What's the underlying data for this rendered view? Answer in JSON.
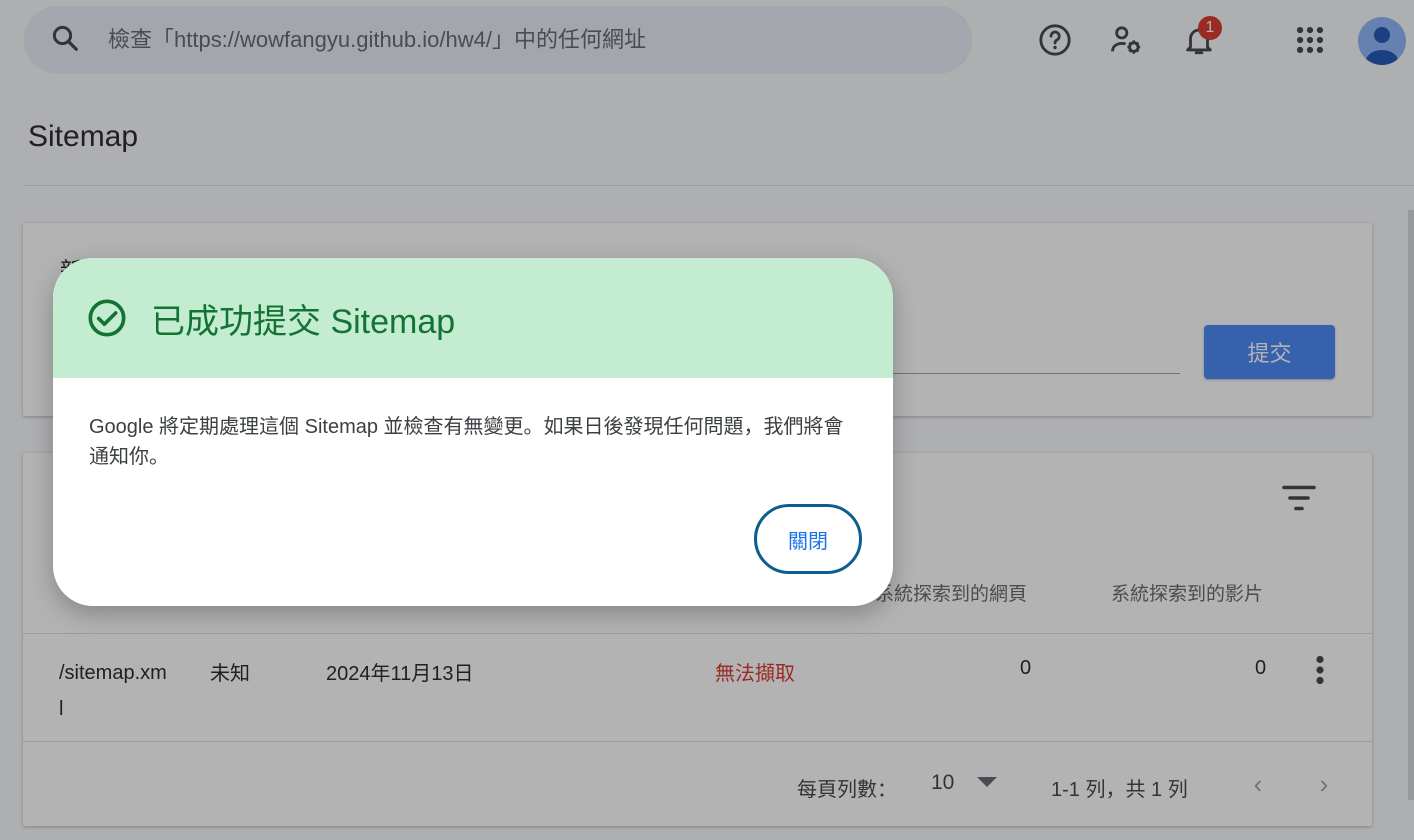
{
  "search": {
    "placeholder": "檢查「https://wowfangyu.github.io/hw4/」中的任何網址"
  },
  "header": {
    "notification_count": "1"
  },
  "page": {
    "title": "Sitemap"
  },
  "add_card": {
    "title": "新增",
    "submit_label": "提交"
  },
  "table": {
    "headers": [
      "系統探索到的網頁",
      "系統探索到的影片"
    ],
    "rows": [
      {
        "sitemap": "/sitemap.xml",
        "type": "未知",
        "submitted": "2024年11月13日",
        "status": "無法擷取",
        "pages": "0",
        "videos": "0"
      }
    ],
    "footer": {
      "rows_per_page_label": "每頁列數：",
      "rows_per_page": "10",
      "range": "1-1 列，共 1 列"
    }
  },
  "dialog": {
    "title": "已成功提交 Sitemap",
    "body": "Google 將定期處理這個 Sitemap 並檢查有無變更。如果日後發現任何問題，我們將會通知你。",
    "close_label": "關閉"
  },
  "colors": {
    "success_bg": "#c3ecd1",
    "success_text": "#137333",
    "error": "#d93025",
    "accent": "#4285f4"
  },
  "icons": [
    "search-icon",
    "help-icon",
    "admin-settings-icon",
    "notifications-icon",
    "apps-icon",
    "avatar-icon",
    "filter-icon",
    "more-vert-icon",
    "check-circle-icon"
  ]
}
